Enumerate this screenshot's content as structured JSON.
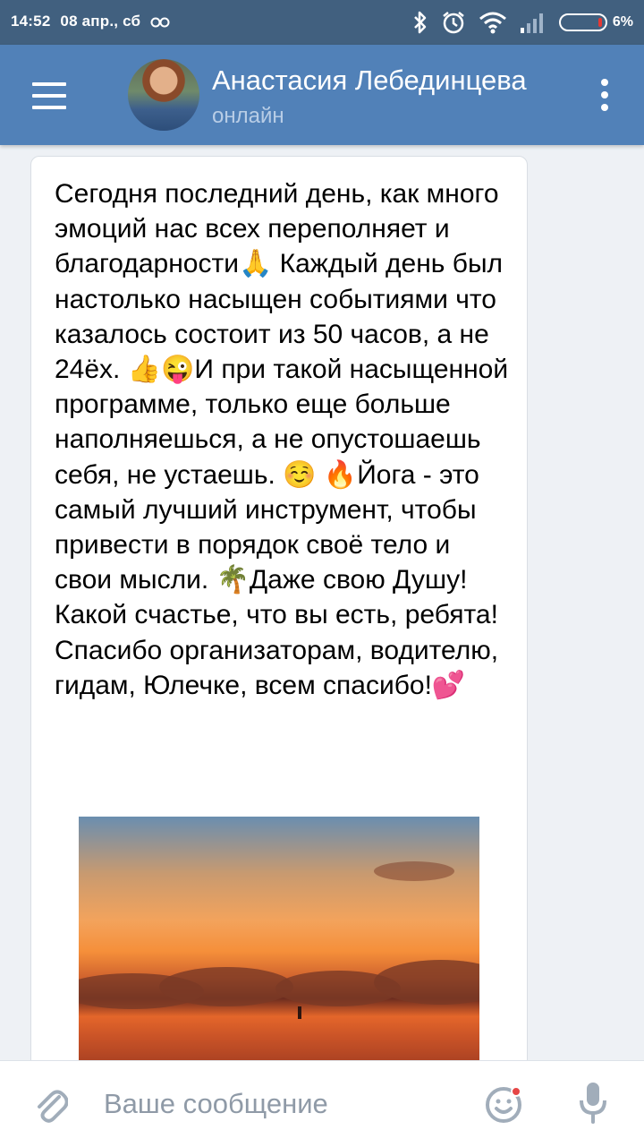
{
  "status_bar": {
    "time": "14:52",
    "date": "08 апр., сб",
    "carrier_icon": "ok-app-icon",
    "battery_percent": "6%",
    "battery_level": 0.06,
    "icons": [
      "bluetooth-icon",
      "alarm-icon",
      "wifi-icon",
      "signal-icon",
      "battery-icon"
    ]
  },
  "header": {
    "contact_name": "Анастасия Лебединцева",
    "presence": "онлайн",
    "menu_icon": "hamburger-menu-icon",
    "more_icon": "more-vertical-icon"
  },
  "message": {
    "text": "Сегодня последний день, как много эмоций нас всех переполняет и благодарности🙏 Каждый день был настолько насыщен событиями что казалось состоит из 50 часов, а не 24ёх. 👍😜И при такой насыщенной программе, только еще больше наполняешься, а не опустошаешь себя, не устаешь. ☺️ 🔥Йога - это самый лучший инструмент, чтобы привести в порядок своё тело и свои мысли. 🌴Даже свою Душу! Какой счастье, что вы есть, ребята! Спасибо организаторам, водителю, гидам, Юлечке, всем спасибо!💕",
    "attachment": "sunset-beach-photo"
  },
  "composer": {
    "placeholder": "Ваше сообщение",
    "value": "",
    "attach_icon": "paperclip-icon",
    "emoji_icon": "emoji-icon",
    "mic_icon": "microphone-icon"
  },
  "colors": {
    "status_bar": "#41607f",
    "header": "#5181b8",
    "background": "#eef1f5",
    "bubble": "#ffffff",
    "placeholder": "#8f9aa7",
    "icon_grey": "#a1adba",
    "notification_dot": "#e64646"
  }
}
